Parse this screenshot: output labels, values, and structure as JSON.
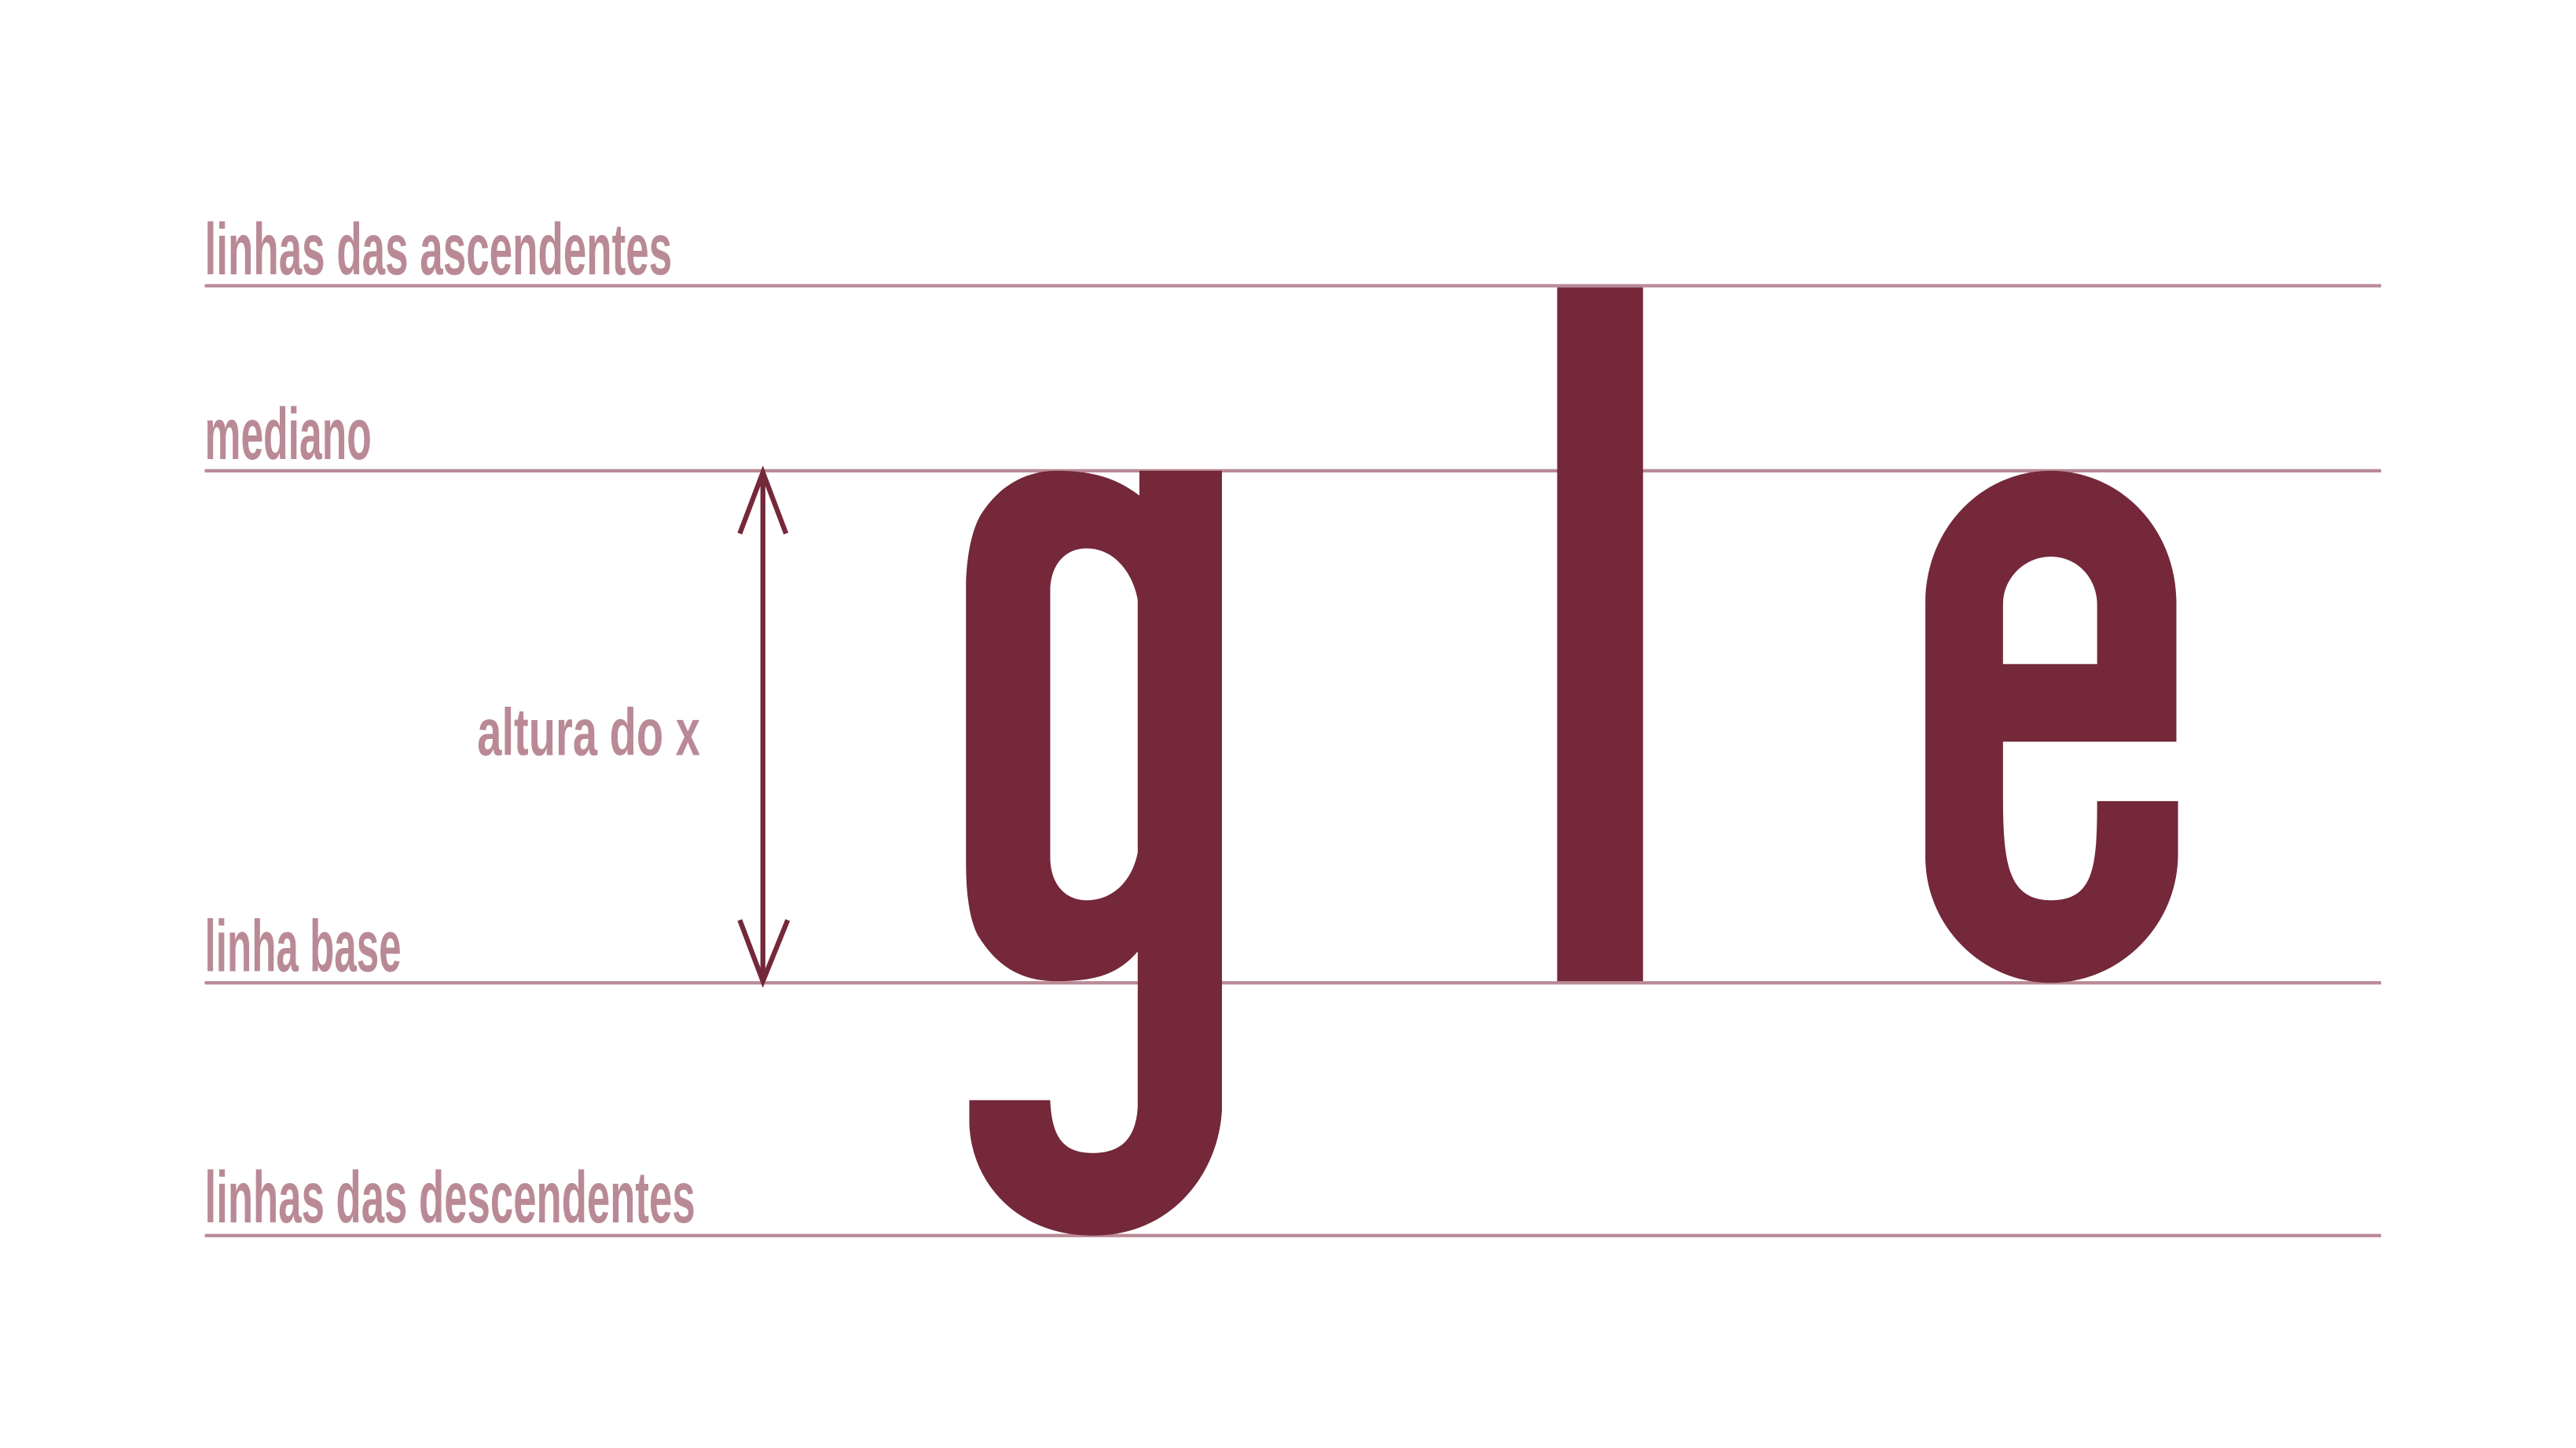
{
  "title": "Anatomia tipográfica",
  "guide_lines": {
    "ascender": "linhas das ascendentes",
    "mean": "mediano",
    "baseline": "linha base",
    "descender": "linhas das descendentes"
  },
  "measure_label": "altura do x",
  "sample_letters": [
    "g",
    "l",
    "e"
  ],
  "colors": {
    "guide": "#b98a96",
    "glyph": "#74283a",
    "background": "#ffffff"
  }
}
